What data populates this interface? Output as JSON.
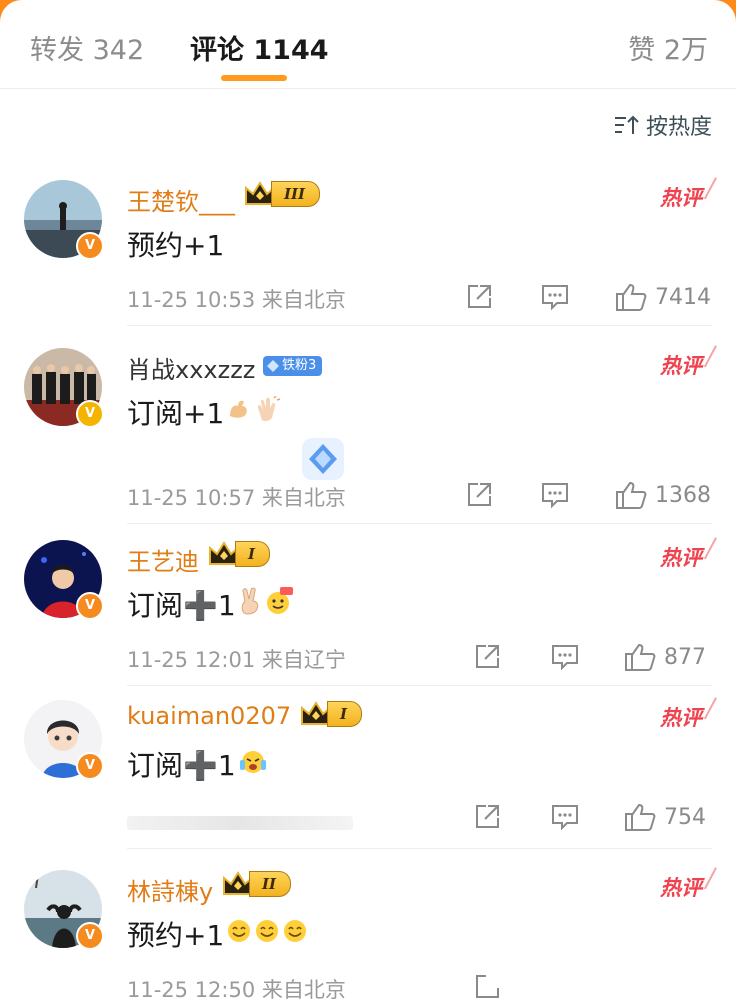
{
  "tabs": {
    "repost": "转发 342",
    "comments": "评论 1144",
    "likes": "赞 2万"
  },
  "sort": {
    "label": "按热度",
    "icon": "sort-icon"
  },
  "comments": [
    {
      "user": "王楚钦___",
      "badge": "III",
      "hot": "热评",
      "text": "预约+1",
      "time": "11-25 10:53",
      "location": "来自北京",
      "likes": "7414"
    },
    {
      "user": "肖战xxxzzz",
      "badge": "铁粉3",
      "hot": "热评",
      "text": "订阅+1",
      "time": "11-25 10:57",
      "location": "来自北京",
      "likes": "1368"
    },
    {
      "user": "王艺迪",
      "badge": "I",
      "hot": "热评",
      "text": "订阅➕1",
      "time": "11-25 12:01",
      "location": "来自辽宁",
      "likes": "877"
    },
    {
      "user": "kuaiman0207",
      "badge": "I",
      "hot": "热评",
      "text": "订阅➕1",
      "time": "",
      "location": "",
      "likes": "754"
    },
    {
      "user": "林詩棟y",
      "badge": "II",
      "hot": "热评",
      "text": "预约+1",
      "time": "11-25 12:50",
      "location": "来自北京",
      "likes": ""
    }
  ],
  "colors": {
    "accent": "#ff9a1f",
    "username": "#e07d17",
    "hot": "#f0424e"
  }
}
